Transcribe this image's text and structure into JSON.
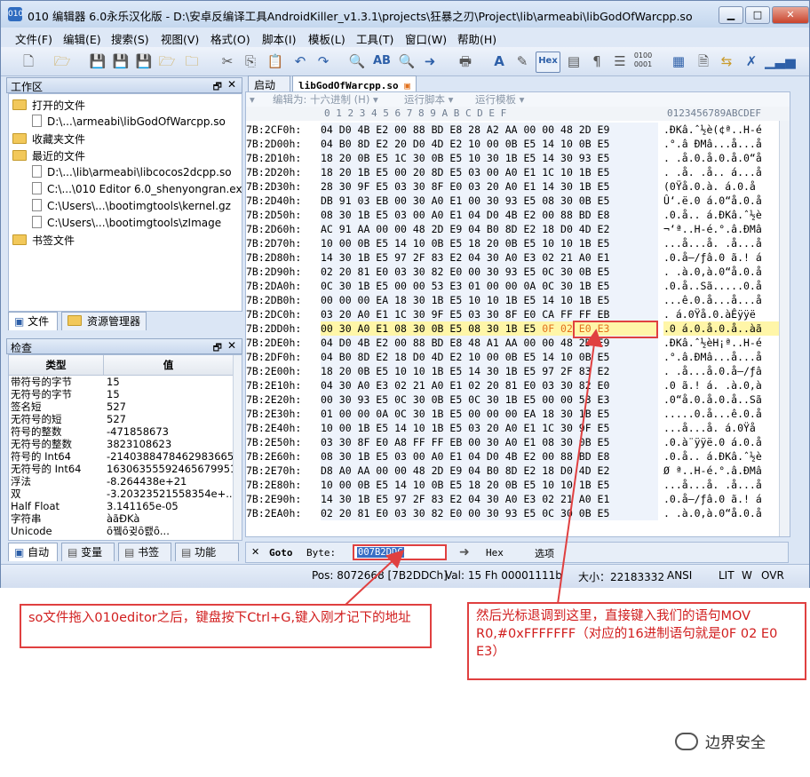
{
  "window": {
    "title": "010 编辑器 6.0永乐汉化版 - D:\\安卓反编译工具AndroidKiller_v1.3.1\\projects\\狂暴之刃\\Project\\lib\\armeabi\\libGodOfWarcpp.so",
    "app_icon_text": "010",
    "minimize": "▁",
    "maximize": "□",
    "close": "✕"
  },
  "menu": [
    "文件(F)",
    "编辑(E)",
    "搜索(S)",
    "视图(V)",
    "格式(O)",
    "脚本(I)",
    "模板(L)",
    "工具(T)",
    "窗口(W)",
    "帮助(H)"
  ],
  "toolbar_icons": [
    "new-file-icon",
    "open-icon",
    "save-icon",
    "save-all-icon",
    "save-as-icon",
    "open-folder-icon",
    "folder-icon",
    "cut-icon",
    "copy-icon",
    "paste-icon",
    "undo-icon",
    "redo-icon",
    "find-icon",
    "replace-icon",
    "find-in-files-icon",
    "goto-icon",
    "print-icon",
    "font-icon",
    "highlight-icon",
    "hex-mode-icon",
    "columns-icon",
    "paragraph-icon",
    "ruler-icon",
    "binary-icon",
    "calculator-icon",
    "inspector-icon",
    "compare-icon",
    "tools-icon",
    "histogram-icon"
  ],
  "workspace": {
    "header": "工作区",
    "pin": "🗗",
    "close": "✕",
    "items": [
      {
        "type": "folder",
        "label": "打开的文件"
      },
      {
        "type": "file",
        "label": "D:\\...\\armeabi\\libGodOfWarcpp.so"
      },
      {
        "type": "folder",
        "label": "收藏夹文件"
      },
      {
        "type": "folder",
        "label": "最近的文件"
      },
      {
        "type": "file",
        "label": "D:\\...\\lib\\armeabi\\libcocos2dcpp.so"
      },
      {
        "type": "file",
        "label": "C:\\...\\010 Editor 6.0_shenyongran.exe"
      },
      {
        "type": "file",
        "label": "C:\\Users\\...\\bootimgtools\\kernel.gz"
      },
      {
        "type": "file",
        "label": "C:\\Users\\...\\bootimgtools\\zImage"
      },
      {
        "type": "folder",
        "label": "书签文件"
      }
    ],
    "tabs": [
      "文件",
      "资源管理器"
    ]
  },
  "inspector": {
    "header": "检查",
    "col_type": "类型",
    "col_value": "值",
    "rows": [
      {
        "type": "带符号的字节",
        "value": "15"
      },
      {
        "type": "无符号的字节",
        "value": "15"
      },
      {
        "type": "签名短",
        "value": "527"
      },
      {
        "type": "无符号的短",
        "value": "527"
      },
      {
        "type": "符号的整数",
        "value": "-471858673"
      },
      {
        "type": "无符号的整数",
        "value": "3823108623"
      },
      {
        "type": "符号的 Int64",
        "value": "-2140388478462983665"
      },
      {
        "type": "无符号的 Int64",
        "value": "16306355592465679951"
      },
      {
        "type": "浮法",
        "value": "-8.264438e+21"
      },
      {
        "type": "双",
        "value": "-3.20323521558354e+..."
      },
      {
        "type": "Half Float",
        "value": "3.141165e-05"
      },
      {
        "type": "字符串",
        "value": "àãÐKà"
      },
      {
        "type": "Unicode",
        "value": "ȏ뀈ȏ귖ȏ뢠ȏ..."
      }
    ],
    "tabs": [
      "自动",
      "变量",
      "书签",
      "功能"
    ]
  },
  "editor": {
    "tabs": [
      "启动",
      "libGodOfWarcpp.so"
    ],
    "subtoolbar": [
      "编辑为: 十六进制 (H) ▾",
      "运行脚本 ▾",
      "运行模板 ▾"
    ],
    "column_header_hex": "0  1  2  3  4  5  6  7  8  9  A  B  C  D  E  F",
    "column_header_ascii": "0123456789ABCDEF",
    "rows": [
      {
        "addr": "7B:2CF0h:",
        "hex": "04 D0 4B E2 00 88 BD E8 28 A2 AA 00 00 48 2D E9",
        "ascii": ".ÐKâ.ˆ½è(¢ª..H-é"
      },
      {
        "addr": "7B:2D00h:",
        "hex": "04 B0 8D E2 20 D0 4D E2 10 00 0B E5 14 10 0B E5",
        "ascii": ".°.â ÐMâ...å...å"
      },
      {
        "addr": "7B:2D10h:",
        "hex": "18 20 0B E5 1C 30 0B E5 10 30 1B E5 14 30 93 E5",
        "ascii": ". .å.0.å.0.å.0“å"
      },
      {
        "addr": "7B:2D20h:",
        "hex": "18 20 1B E5 00 20 8D E5 03 00 A0 E1 1C 10 1B E5",
        "ascii": ". .å. .å.. á...å"
      },
      {
        "addr": "7B:2D30h:",
        "hex": "28 30 9F E5 03 30 8F E0 03 20 A0 E1 14 30 1B E5",
        "ascii": "(0Ÿå.0.à. á.0.å"
      },
      {
        "addr": "7B:2D40h:",
        "hex": "DB 91 03 EB 00 30 A0 E1 00 30 93 E5 08 30 0B E5",
        "ascii": "Û‘.ë.0 á.0“å.0.å"
      },
      {
        "addr": "7B:2D50h:",
        "hex": "08 30 1B E5 03 00 A0 E1 04 D0 4B E2 00 88 BD E8",
        "ascii": ".0.å.. á.ÐKâ.ˆ½è"
      },
      {
        "addr": "7B:2D60h:",
        "hex": "AC 91 AA 00 00 48 2D E9 04 B0 8D E2 18 D0 4D E2",
        "ascii": "¬‘ª..H-é.°.â.ÐMâ"
      },
      {
        "addr": "7B:2D70h:",
        "hex": "10 00 0B E5 14 10 0B E5 18 20 0B E5 10 10 1B E5",
        "ascii": "...å...å. .å...å"
      },
      {
        "addr": "7B:2D80h:",
        "hex": "14 30 1B E5 97 2F 83 E2 04 30 A0 E3 02 21 A0 E1",
        "ascii": ".0.å—/ƒâ.0 ã.! á"
      },
      {
        "addr": "7B:2D90h:",
        "hex": "02 20 81 E0 03 30 82 E0 00 30 93 E5 0C 30 0B E5",
        "ascii": ". .à.0‚à.0“å.0.å"
      },
      {
        "addr": "7B:2DA0h:",
        "hex": "0C 30 1B E5 00 00 53 E3 01 00 00 0A 0C 30 1B E5",
        "ascii": ".0.å..Sã.....0.å"
      },
      {
        "addr": "7B:2DB0h:",
        "hex": "00 00 00 EA 18 30 1B E5 10 10 1B E5 14 10 1B E5",
        "ascii": "...ê.0.å...å...å"
      },
      {
        "addr": "7B:2DC0h:",
        "hex": "03 20 A0 E1 1C 30 9F E5 03 30 8F E0 CA FF FF EB",
        "ascii": ". á.0Ÿå.0.àÊÿÿë"
      },
      {
        "addr": "7B:2DD0h:",
        "hex": "00 30 A0 E1 08 30 0B E5 08 30 1B E5",
        "sel": "0F 02 E0 E3",
        "ascii": ".0 á.0.å.0.å..àã",
        "highlight": true
      },
      {
        "addr": "7B:2DE0h:",
        "hex": "04 D0 4B E2 00 88 BD E8 48 A1 AA 00 00 48 2D E9",
        "ascii": ".ÐKâ.ˆ½èH¡ª..H-é"
      },
      {
        "addr": "7B:2DF0h:",
        "hex": "04 B0 8D E2 18 D0 4D E2 10 00 0B E5 14 10 0B E5",
        "ascii": ".°.â.ÐMâ...å...å"
      },
      {
        "addr": "7B:2E00h:",
        "hex": "18 20 0B E5 10 10 1B E5 14 30 1B E5 97 2F 83 E2",
        "ascii": ". .å...å.0.å—/ƒâ"
      },
      {
        "addr": "7B:2E10h:",
        "hex": "04 30 A0 E3 02 21 A0 E1 02 20 81 E0 03 30 82 E0",
        "ascii": ".0 ã.! á. .à.0‚à"
      },
      {
        "addr": "7B:2E20h:",
        "hex": "00 30 93 E5 0C 30 0B E5 0C 30 1B E5 00 00 53 E3",
        "ascii": ".0“å.0.å.0.å..Sã"
      },
      {
        "addr": "7B:2E30h:",
        "hex": "01 00 00 0A 0C 30 1B E5 00 00 00 EA 18 30 1B E5",
        "ascii": ".....0.å...ê.0.å"
      },
      {
        "addr": "7B:2E40h:",
        "hex": "10 00 1B E5 14 10 1B E5 03 20 A0 E1 1C 30 9F E5",
        "ascii": "...å...å. á.0Ÿå"
      },
      {
        "addr": "7B:2E50h:",
        "hex": "03 30 8F E0 A8 FF FF EB 00 30 A0 E1 08 30 0B E5",
        "ascii": ".0.à¨ÿÿë.0 á.0.å"
      },
      {
        "addr": "7B:2E60h:",
        "hex": "08 30 1B E5 03 00 A0 E1 04 D0 4B E2 00 88 BD E8",
        "ascii": ".0.å.. á.ÐKâ.ˆ½è"
      },
      {
        "addr": "7B:2E70h:",
        "hex": "D8 A0 AA 00 00 48 2D E9 04 B0 8D E2 18 D0 4D E2",
        "ascii": "Ø ª..H-é.°.â.ÐMâ"
      },
      {
        "addr": "7B:2E80h:",
        "hex": "10 00 0B E5 14 10 0B E5 18 20 0B E5 10 10 1B E5",
        "ascii": "...å...å. .å...å"
      },
      {
        "addr": "7B:2E90h:",
        "hex": "14 30 1B E5 97 2F 83 E2 04 30 A0 E3 02 21 A0 E1",
        "ascii": ".0.å—/ƒâ.0 ã.! á"
      },
      {
        "addr": "7B:2EA0h:",
        "hex": "02 20 81 E0 03 30 82 E0 00 30 93 E5 0C 30 0B E5",
        "ascii": ". .à.0‚à.0“å.0.å"
      }
    ]
  },
  "gotobar": {
    "close": "✕",
    "goto_label": "Goto",
    "byte_label": "Byte:",
    "address_value": "007B2DDC",
    "go_arrow": "➜",
    "format": "Hex",
    "options": "选项"
  },
  "status": {
    "pos": "Pos: 8072668 [7B2DDCh]",
    "val": "Val: 15 Fh 00001111b",
    "size": "大小：22183332",
    "encoding": "ANSI",
    "endian": "LIT",
    "write": "W",
    "mode": "OVR"
  },
  "annotations": {
    "left": "so文件拖入010editor之后，键盘按下Ctrl+G,键入刚才记下的地址",
    "right": "然后光标退调到这里，直接键入我们的语句MOV  R0,#0xFFFFFFF（对应的16进制语句就是0F 02 E0 E3）"
  },
  "watermark": "边界安全",
  "colors": {
    "accent_red": "#e04040",
    "highlight_yellow": "#fff6a8",
    "selected_bytes": "#e2711d"
  }
}
